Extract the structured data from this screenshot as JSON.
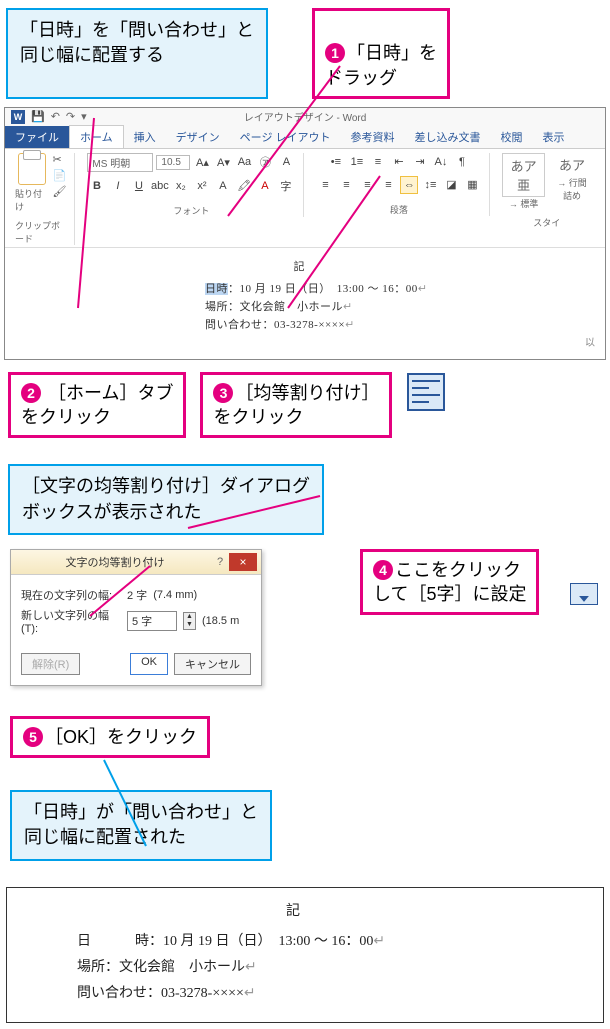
{
  "callouts": {
    "c1": "「日時」を「問い合わせ」と\n同じ幅に配置する",
    "p1_num": "1",
    "p1": "「日時」を\nドラッグ",
    "p2_num": "2",
    "p2": " ［ホーム］タブ\nをクリック",
    "p3_num": "3",
    "p3": "［均等割り付け］\nをクリック",
    "c2": "［文字の均等割り付け］ダイアログ\nボックスが表示された",
    "p4_num": "4",
    "p4": "ここをクリック\nして［5字］に設定",
    "p5_num": "5",
    "p5": "［OK］をクリック",
    "c3": "「日時」が「問い合わせ」と\n同じ幅に配置された"
  },
  "ribbon": {
    "title": "レイアウトデザイン - Word",
    "tabs": [
      "ファイル",
      "ホーム",
      "挿入",
      "デザイン",
      "ページ レイアウト",
      "参考資料",
      "差し込み文書",
      "校閲",
      "表示"
    ],
    "paste_label": "貼り付け",
    "clipboard_group": "クリップボード",
    "font_name": "MS 明朝",
    "font_size": "10.5",
    "font_group": "フォント",
    "para_group": "段落",
    "style_label1": "あア亜",
    "style_label2": "あア",
    "style_sub1": "→ 標準",
    "style_sub2": "→ 行間詰め",
    "style_group": "スタイ"
  },
  "doc": {
    "ki": "記",
    "line1_label": "日時",
    "line1": "：10 月 19 日（日）　13:00 ～ 16：00",
    "line2": "場所：文化会館　小ホール",
    "line3": "問い合わせ：03-3278-××××",
    "ijou": "以"
  },
  "dialog": {
    "title": "文字の均等割り付け",
    "current_label": "現在の文字列の幅:",
    "current_value": "2 字",
    "current_mm": "(7.4 mm)",
    "new_label": "新しい文字列の幅(T):",
    "new_value": "5 字",
    "new_mm": "(18.5 m",
    "release": "解除(R)",
    "ok": "OK",
    "cancel": "キャンセル"
  },
  "result": {
    "ki": "記",
    "line1_a": "日",
    "line1_b": "時",
    "line1_rest": "：10 月 19 日（日）　13:00 ～ 16：00",
    "line2": "場所：文化会館　小ホール",
    "line3": "問い合わせ：03-3278-××××"
  }
}
